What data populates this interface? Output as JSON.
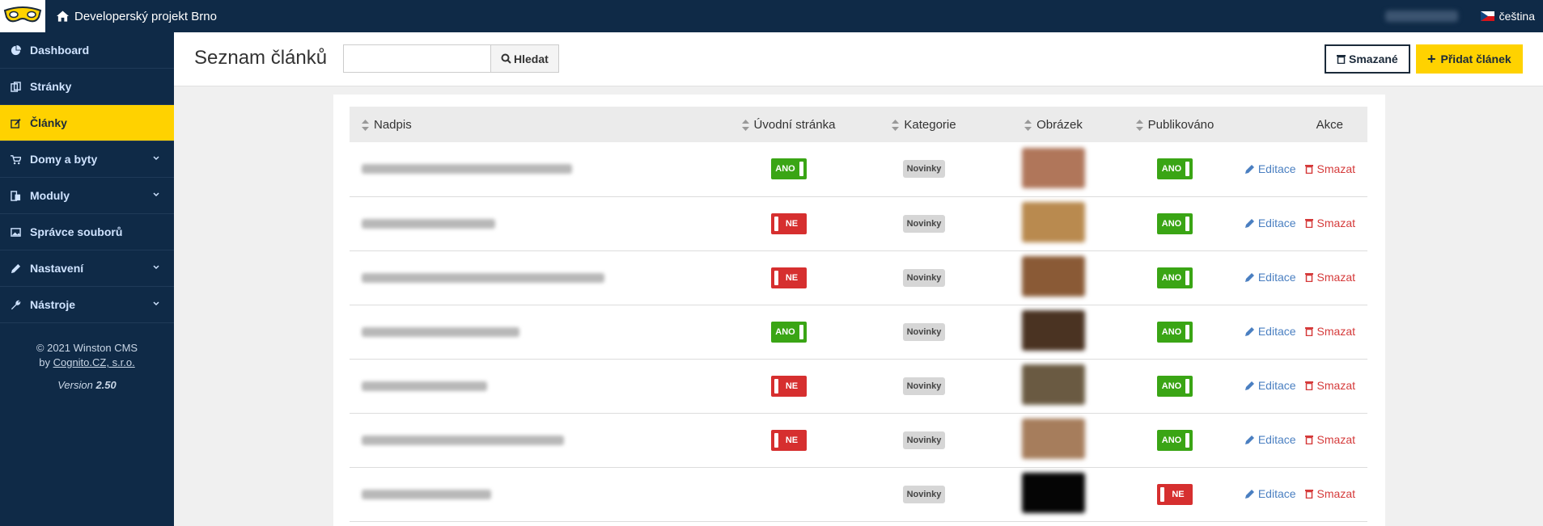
{
  "topbar": {
    "project_title": "Developerský projekt Brno",
    "language": "čeština"
  },
  "sidebar": {
    "items": [
      {
        "label": "Dashboard",
        "icon": "dashboard-icon"
      },
      {
        "label": "Stránky",
        "icon": "pages-icon"
      },
      {
        "label": "Články",
        "icon": "edit-icon"
      },
      {
        "label": "Domy a byty",
        "icon": "cart-icon"
      },
      {
        "label": "Moduly",
        "icon": "modules-icon"
      },
      {
        "label": "Správce souborů",
        "icon": "image-icon"
      },
      {
        "label": "Nastavení",
        "icon": "pencil-icon"
      },
      {
        "label": "Nástroje",
        "icon": "wrench-icon"
      }
    ],
    "footer_copyright": "© 2021 Winston CMS",
    "footer_by": "by",
    "footer_company": "Cognito.CZ, s.r.o.",
    "version_label": "Version",
    "version_number": "2.50"
  },
  "header": {
    "page_title": "Seznam článků",
    "search_placeholder": "",
    "search_button": "Hledat",
    "deleted_button": "Smazané",
    "add_button": "Přidat článek"
  },
  "table": {
    "columns": [
      "Nadpis",
      "Úvodní stránka",
      "Kategorie",
      "Obrázek",
      "Publikováno",
      "Akce"
    ],
    "rows": [
      {
        "homepage": "ANO",
        "category": "Novinky",
        "published": "ANO",
        "edit": "Editace",
        "delete": "Smazat",
        "thumb_color": "#b0765a"
      },
      {
        "homepage": "NE",
        "category": "Novinky",
        "published": "ANO",
        "edit": "Editace",
        "delete": "Smazat",
        "thumb_color": "#b98a4f"
      },
      {
        "homepage": "NE",
        "category": "Novinky",
        "published": "ANO",
        "edit": "Editace",
        "delete": "Smazat",
        "thumb_color": "#8a5a36"
      },
      {
        "homepage": "ANO",
        "category": "Novinky",
        "published": "ANO",
        "edit": "Editace",
        "delete": "Smazat",
        "thumb_color": "#4a3322"
      },
      {
        "homepage": "NE",
        "category": "Novinky",
        "published": "ANO",
        "edit": "Editace",
        "delete": "Smazat",
        "thumb_color": "#6a5a42"
      },
      {
        "homepage": "NE",
        "category": "Novinky",
        "published": "ANO",
        "edit": "Editace",
        "delete": "Smazat",
        "thumb_color": "#a67d5c"
      },
      {
        "homepage": "",
        "category": "Novinky",
        "published": "NE",
        "edit": "Editace",
        "delete": "Smazat",
        "thumb_color": "#050505"
      }
    ]
  },
  "colors": {
    "navy": "#0f2a47",
    "accent_yellow": "#ffd200",
    "toggle_on": "#3aa515",
    "toggle_off": "#d62f2f",
    "link_blue": "#4a7fc1",
    "link_red": "#d53a3a"
  }
}
